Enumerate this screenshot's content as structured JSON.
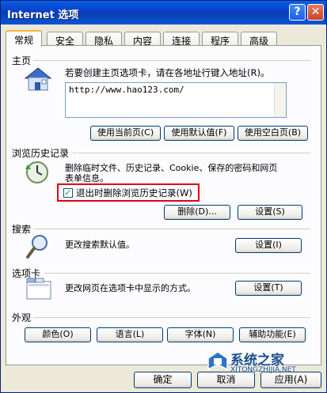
{
  "window": {
    "title": "Internet 选项",
    "help_glyph": "?",
    "close_glyph": "✕"
  },
  "tabs": [
    {
      "label": "常规",
      "active": true
    },
    {
      "label": "安全"
    },
    {
      "label": "隐私"
    },
    {
      "label": "内容"
    },
    {
      "label": "连接"
    },
    {
      "label": "程序"
    },
    {
      "label": "高级"
    }
  ],
  "homepage": {
    "group_label": "主页",
    "description": "若要创建主页选项卡，请在各地址行键入地址(R)。",
    "url": "http://www.hao123.com/",
    "use_current": "使用当前页(C)",
    "use_default": "使用默认值(F)",
    "use_blank": "使用空白页(B)"
  },
  "history": {
    "group_label": "浏览历史记录",
    "description_line1": "删除临时文件、历史记录、Cookie、保存的密码和网页",
    "description_line2": "表单信息。",
    "checkbox_label": "退出时删除浏览历史记录(W)",
    "checkbox_checked": true,
    "delete_button": "删除(D)...",
    "settings_button": "设置(S)"
  },
  "search": {
    "group_label": "搜索",
    "description": "更改搜索默认值。",
    "settings_button": "设置(I)"
  },
  "tabs_section": {
    "group_label": "选项卡",
    "description": "更改网页在选项卡中显示的方式。",
    "settings_button": "设置(T)"
  },
  "appearance": {
    "group_label": "外观",
    "colors": "颜色(O)",
    "languages": "语言(L)",
    "fonts": "字体(N)",
    "accessibility": "辅助功能(E)"
  },
  "footer": {
    "ok": "确定",
    "cancel": "取消",
    "apply": "应用(A)"
  },
  "watermark": {
    "name": "系统之家",
    "url": "XITONGZHIJIA.NET"
  },
  "colors": {
    "titlebar": "#0a3fc4",
    "highlight_box": "#e0001b",
    "dialog_bg": "#ece9d8"
  }
}
